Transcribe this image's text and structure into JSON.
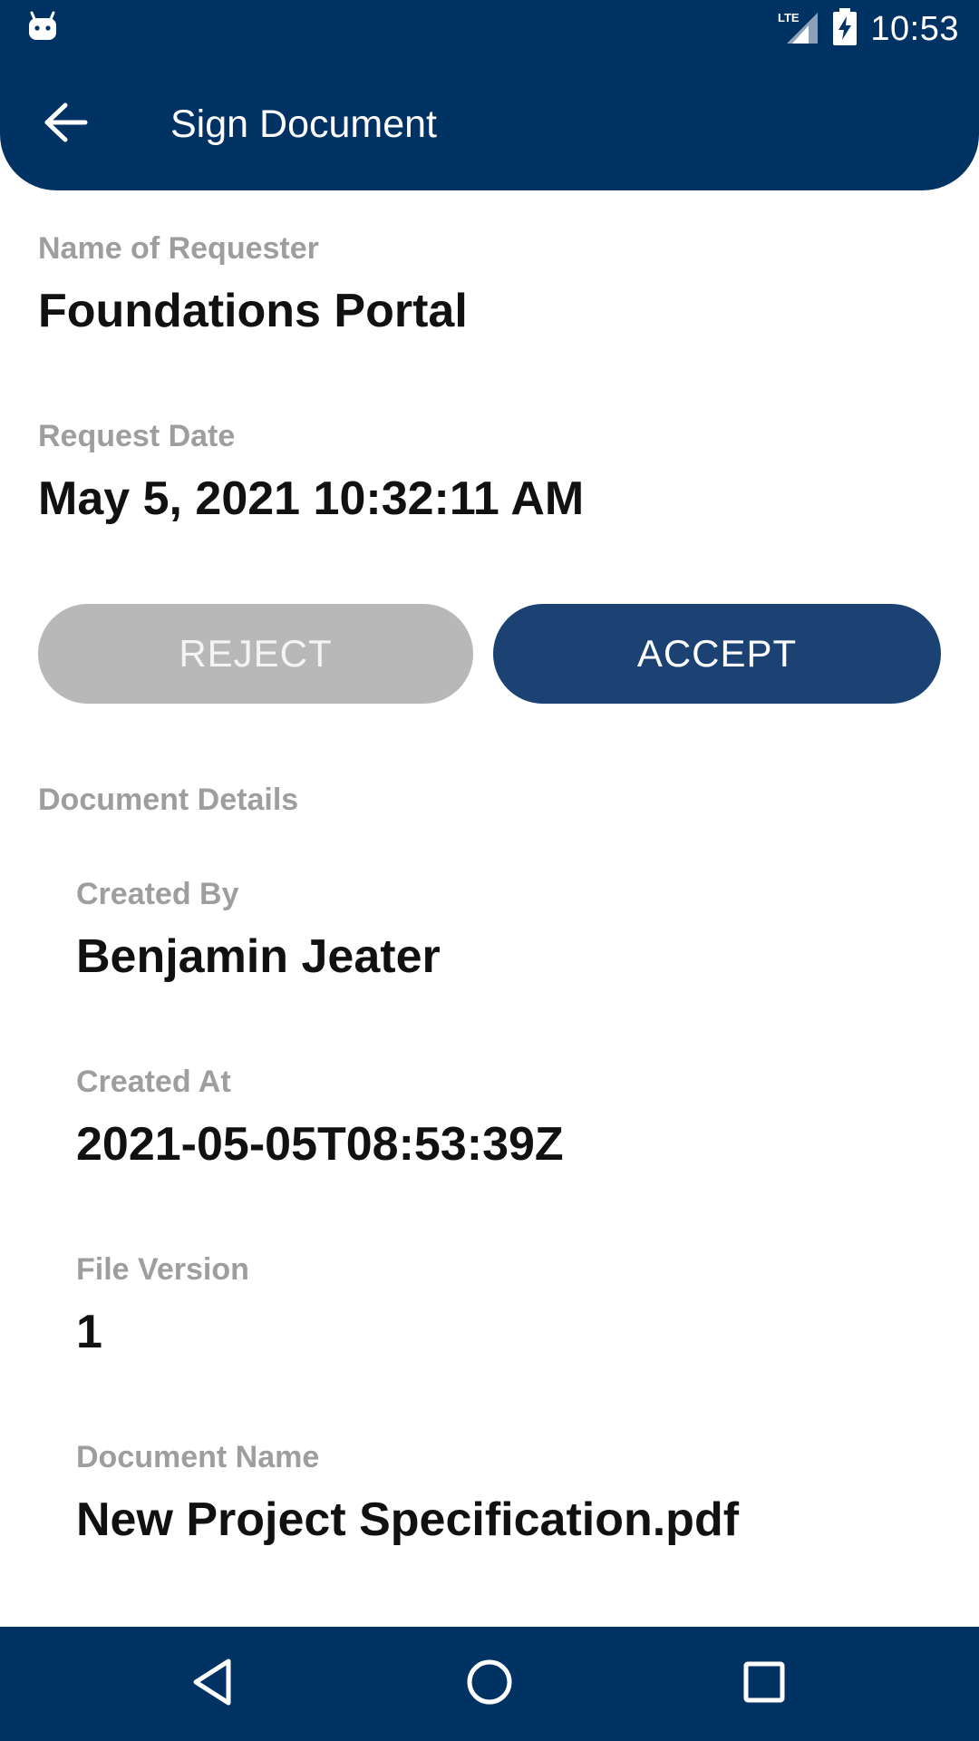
{
  "status_bar": {
    "time": "10:53",
    "network": "LTE",
    "icons": [
      "android-icon",
      "lte-signal-icon",
      "battery-charging-icon"
    ]
  },
  "app_bar": {
    "title": "Sign Document",
    "back_icon": "arrow-left-icon"
  },
  "request": {
    "requester_label": "Name of Requester",
    "requester_value": "Foundations Portal",
    "date_label": "Request Date",
    "date_value": "May 5, 2021 10:32:11 AM"
  },
  "actions": {
    "reject_label": "REJECT",
    "accept_label": "ACCEPT"
  },
  "document_details": {
    "section_label": "Document Details",
    "fields": [
      {
        "label": "Created By",
        "value": "Benjamin Jeater"
      },
      {
        "label": "Created At",
        "value": "2021-05-05T08:53:39Z"
      },
      {
        "label": "File Version",
        "value": "1"
      },
      {
        "label": "Document Name",
        "value": "New Project Specification.pdf"
      }
    ]
  },
  "nav_bar": {
    "icons": [
      "nav-back-icon",
      "nav-home-icon",
      "nav-recents-icon"
    ]
  },
  "colors": {
    "primary": "#003263",
    "accept_button": "#1c4274",
    "reject_button": "#b8b8b8",
    "label_gray": "#9e9e9e"
  }
}
